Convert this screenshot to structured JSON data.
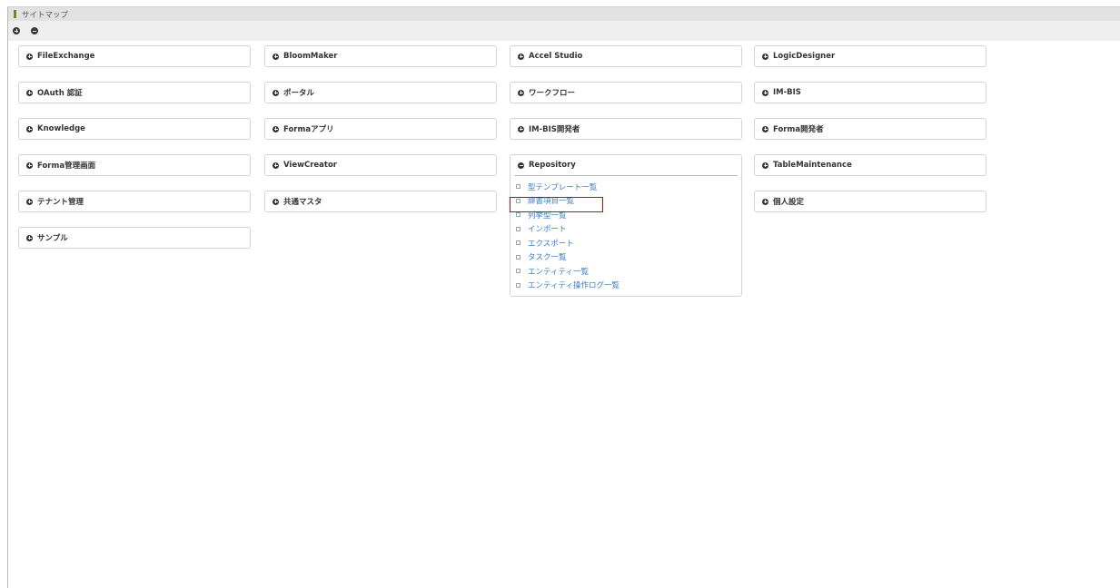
{
  "window": {
    "title": "サイトマップ"
  },
  "toolbar": {
    "expand_all": "expand-all",
    "collapse_all": "collapse-all"
  },
  "columns": [
    {
      "cards": [
        {
          "label": "FileExchange"
        },
        {
          "label": "OAuth 認証"
        },
        {
          "label": "Knowledge"
        },
        {
          "label": "Forma管理画面"
        },
        {
          "label": "テナント管理"
        },
        {
          "label": "サンプル"
        }
      ]
    },
    {
      "cards": [
        {
          "label": "BloomMaker"
        },
        {
          "label": "ポータル"
        },
        {
          "label": "Formaアプリ"
        },
        {
          "label": "ViewCreator"
        },
        {
          "label": "共通マスタ"
        }
      ]
    },
    {
      "cards": [
        {
          "label": "Accel Studio"
        },
        {
          "label": "ワークフロー"
        },
        {
          "label": "IM-BIS開発者"
        },
        {
          "label": "Repository",
          "expanded": true,
          "items": [
            "型テンプレート一覧",
            "辞書項目一覧",
            "列挙型一覧",
            "インポート",
            "エクスポート",
            "タスク一覧",
            "エンティティ一覧",
            "エンティティ操作ログ一覧"
          ]
        }
      ]
    },
    {
      "cards": [
        {
          "label": "LogicDesigner"
        },
        {
          "label": "IM-BIS"
        },
        {
          "label": "Forma開発者"
        },
        {
          "label": "TableMaintenance"
        },
        {
          "label": "個人設定"
        }
      ]
    }
  ],
  "colors": {
    "link": "#3b7dc4",
    "highlight": "#e00000"
  }
}
